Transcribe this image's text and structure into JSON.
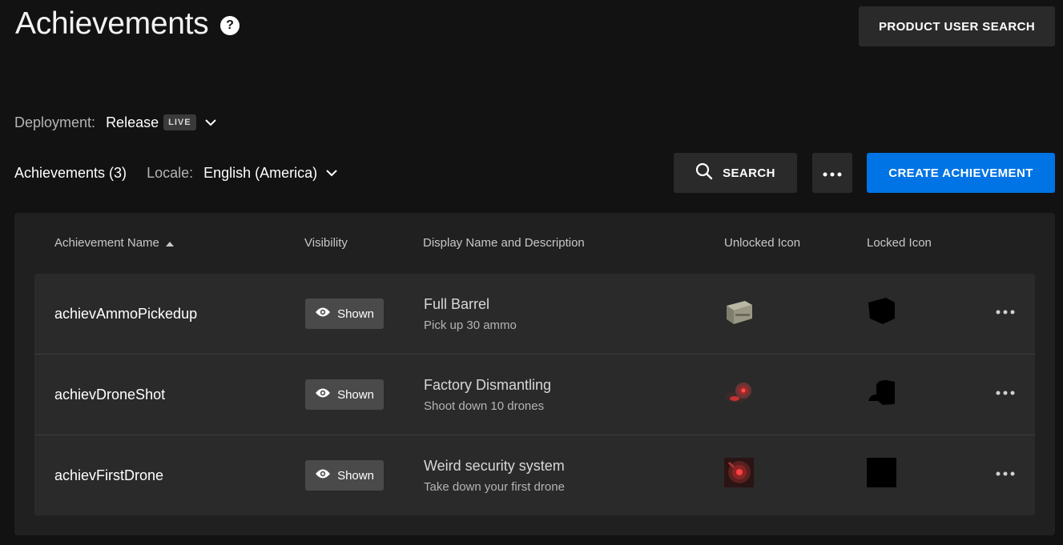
{
  "header": {
    "title": "Achievements",
    "help_glyph": "?",
    "product_user_search_label": "PRODUCT USER SEARCH"
  },
  "deployment": {
    "label": "Deployment:",
    "value": "Release",
    "badge": "LIVE"
  },
  "filters": {
    "achievements_count": "Achievements (3)",
    "locale_label": "Locale:",
    "locale_value": "English (America)"
  },
  "toolbar": {
    "search_label": "SEARCH",
    "create_label": "CREATE ACHIEVEMENT"
  },
  "table": {
    "headers": {
      "name": "Achievement Name",
      "visibility": "Visibility",
      "display": "Display Name and Description",
      "unlocked": "Unlocked Icon",
      "locked": "Locked Icon"
    },
    "rows": [
      {
        "name": "achievAmmoPickedup",
        "visibility": "Shown",
        "title": "Full Barrel",
        "description": "Pick up 30 ammo"
      },
      {
        "name": "achievDroneShot",
        "visibility": "Shown",
        "title": "Factory Dismantling",
        "description": "Shoot down 10 drones"
      },
      {
        "name": "achievFirstDrone",
        "visibility": "Shown",
        "title": "Weird security system",
        "description": "Take down your first drone"
      }
    ]
  },
  "colors": {
    "background": "#121212",
    "panel": "#202020",
    "row": "#2a2a2a",
    "accent": "#0074e4"
  }
}
